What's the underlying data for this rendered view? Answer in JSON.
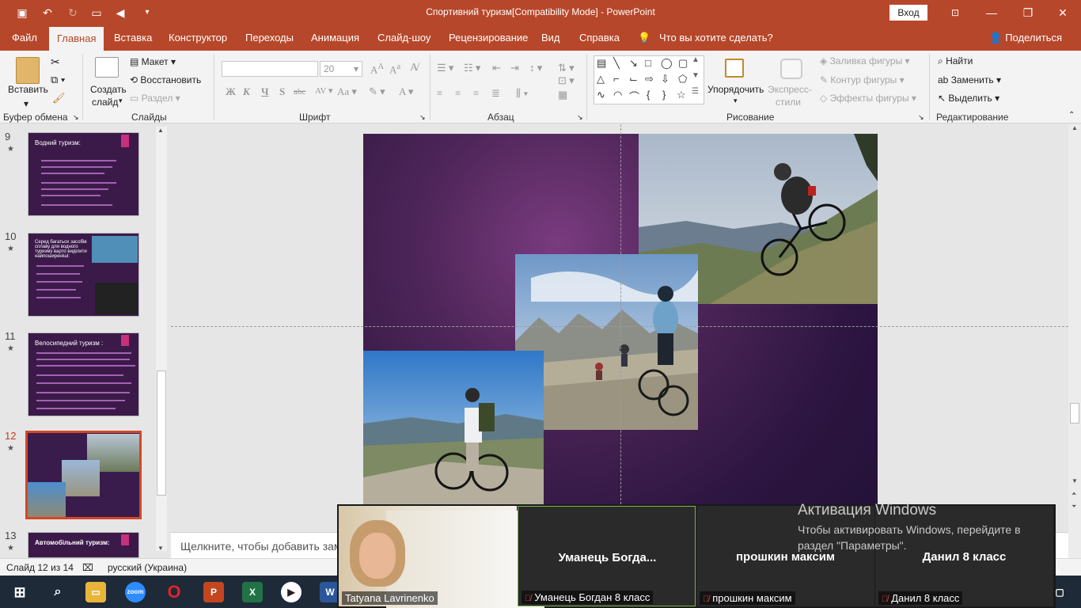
{
  "titlebar": {
    "title": "Спортивний туризм[Compatibility Mode]  -  PowerPoint",
    "login": "Вход"
  },
  "tabs": [
    "Файл",
    "Главная",
    "Вставка",
    "Конструктор",
    "Переходы",
    "Анимация",
    "Слайд-шоу",
    "Рецензирование",
    "Вид",
    "Справка"
  ],
  "active_tab": "Главная",
  "tell_me": "Что вы хотите сделать?",
  "share": "Поделиться",
  "ribbon": {
    "clipboard": {
      "paste": "Вставить",
      "label": "Буфер обмена"
    },
    "slides": {
      "new_slide": "Создать",
      "new_slide2": "слайд",
      "layout": "Макет",
      "reset": "Восстановить",
      "section": "Раздел",
      "label": "Слайды"
    },
    "font": {
      "size": "20",
      "bold": "Ж",
      "italic": "К",
      "underline": "Ч",
      "shadow": "S",
      "strike": "abc",
      "label": "Шрифт"
    },
    "paragraph": {
      "label": "Абзац"
    },
    "drawing": {
      "arrange": "Упорядочить",
      "quick_styles": "Экспресс-",
      "quick_styles2": "стили",
      "fill": "Заливка фигуры",
      "outline": "Контур фигуры",
      "effects": "Эффекты фигуры",
      "label": "Рисование"
    },
    "editing": {
      "find": "Найти",
      "replace": "Заменить",
      "select": "Выделить",
      "label": "Редактирование"
    }
  },
  "slides": [
    {
      "num": "9",
      "title": "Водний туризм:"
    },
    {
      "num": "10",
      "title": "Серед багатьох засобів сплаву для водного туризму варто виділити найпоширеніші:"
    },
    {
      "num": "11",
      "title": "Велосипедний туризм :"
    },
    {
      "num": "12",
      "title": ""
    },
    {
      "num": "13",
      "title": "Автомобільний туризм:"
    }
  ],
  "notes_placeholder": "Щелкните, чтобы добавить заметки",
  "status": {
    "slide": "Слайд 12 из 14",
    "lang": "русский (Украина)"
  },
  "zoom": {
    "self": "Tatyana Lavrinenko",
    "participants": [
      {
        "display": "Уманець  Богда...",
        "label": "Уманець Богдан 8 класс"
      },
      {
        "display": "прошкин максим",
        "label": "прошкин максим"
      },
      {
        "display": "Данил 8 класс",
        "label": "Данил 8 класс"
      }
    ]
  },
  "activation": {
    "heading": "Активация Windows",
    "text": "Чтобы активировать Windows, перейдите в раздел \"Параметры\"."
  },
  "taskbar": [
    "start-icon",
    "search-icon",
    "file-explorer-icon",
    "zoom-icon",
    "opera-icon",
    "powerpoint-icon",
    "excel-icon",
    "media-player-icon",
    "word-icon"
  ]
}
